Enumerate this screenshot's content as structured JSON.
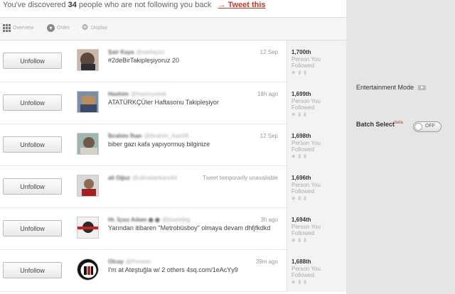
{
  "banner": {
    "prefix": "You've discovered",
    "count": "34",
    "suffix": "people who are not following you back",
    "arrow": "→",
    "tweet_link": "Tweet this"
  },
  "toolbar": {
    "overview": "Overview",
    "order": "Order",
    "display": "Display"
  },
  "rows": [
    {
      "button": "Unfollow",
      "name": "Şair Kaya",
      "handle": "@sarkaya1",
      "time": "12 Sep",
      "tweet": "#2deBirTakipleşiyoruz 20",
      "rank": "1,700th",
      "rank_label": "Person You Followed"
    },
    {
      "button": "Unfollow",
      "name": "Hashim",
      "handle": "@hasimyetisk",
      "time": "18h ago",
      "tweet": "ATATÜRKÇÜler Haftasonu Takipleşiyor",
      "rank": "1,699th",
      "rank_label": "Person You Followed"
    },
    {
      "button": "Unfollow",
      "name": "İbrahim İhan",
      "handle": "@ibrahim_ihan06",
      "time": "12 Sep",
      "tweet": "biber gazı kafa yapıyormuş bilginize",
      "rank": "1,698th",
      "rank_label": "Person You Followed"
    },
    {
      "button": "Unfollow",
      "name": "ali Oğuz",
      "handle": "@ultraslankara44",
      "time": "Tweet temporarily unavailable",
      "tweet": "",
      "rank": "1,696th",
      "rank_label": "Person You Followed"
    },
    {
      "button": "Unfollow",
      "name": "Hr. İçsız Adam ◉ ◉",
      "handle": "@bisebibig",
      "time": "3h ago",
      "tweet": "Yarından itibaren \"Metrobüsboy\" olmaya devam dhfjfkdkd",
      "rank": "1,694th",
      "rank_label": "Person You Followed"
    },
    {
      "button": "Unfollow",
      "name": "Olcay",
      "handle": "@Ponean",
      "time": "39m ago",
      "tweet": "I'm at Ateştuğla w/ 2 others 4sq.com/1eAcYy9",
      "rank": "1,688th",
      "rank_label": "Person You Followed"
    }
  ],
  "right_panel": {
    "entertainment": "Entertainment Mode",
    "batch": "Batch Select",
    "beta": "beta",
    "toggle": "OFF"
  },
  "colors": {
    "link": "#c0392b",
    "panel": "#e5e5e5"
  }
}
